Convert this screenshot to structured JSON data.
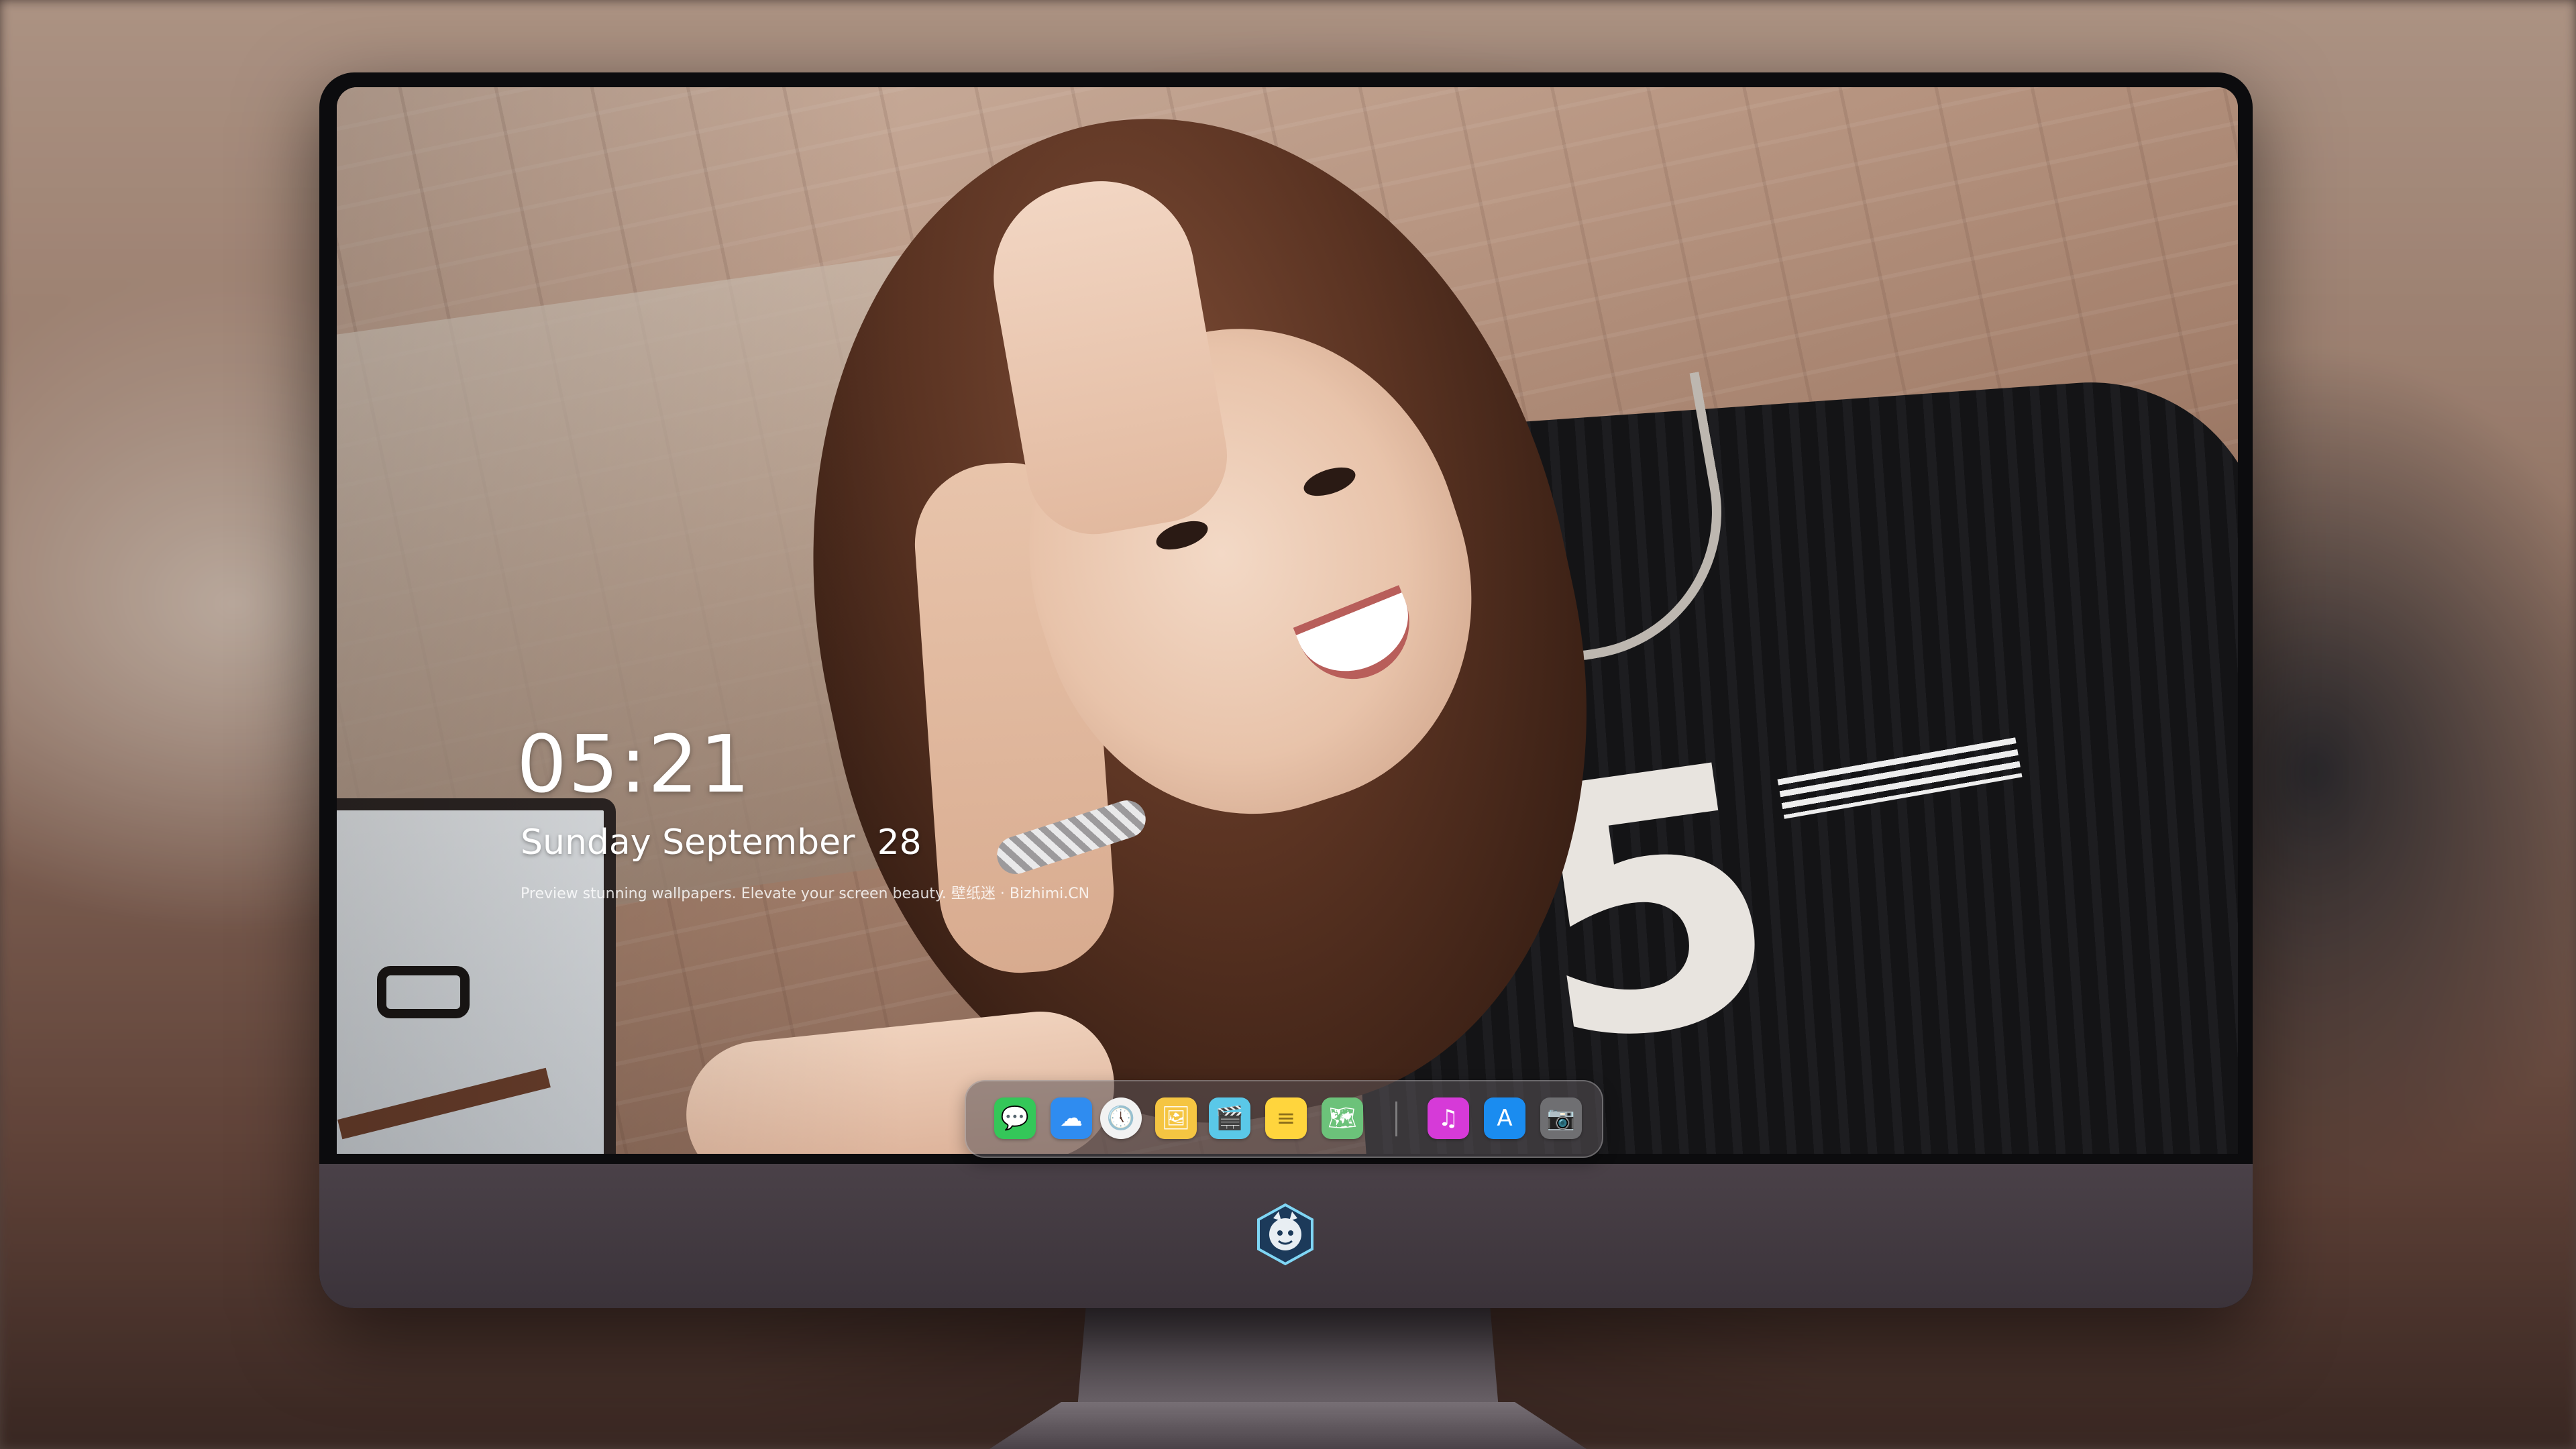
{
  "lock_screen": {
    "time": "05:21",
    "date": "Sunday September  28",
    "tagline": "Preview stunning wallpapers. Elevate your screen beauty. 壁纸迷 · Bizhimi.CN"
  },
  "wallpaper": {
    "shirt_number": "5"
  },
  "dock": {
    "apps": [
      {
        "name": "Messages",
        "icon": "messages-icon",
        "glyph": "💬",
        "color": "#34c759"
      },
      {
        "name": "Weather",
        "icon": "weather-icon",
        "glyph": "☁",
        "color": "#2f8cf0"
      },
      {
        "name": "Clock",
        "icon": "clock-icon",
        "glyph": "🕔",
        "color": "#f2f2f2"
      },
      {
        "name": "Preview",
        "icon": "preview-icon",
        "glyph": "🖼",
        "color": "#f5c542"
      },
      {
        "name": "Video",
        "icon": "video-icon",
        "glyph": "🎬",
        "color": "#5ac8e8"
      },
      {
        "name": "Notes",
        "icon": "notes-icon",
        "glyph": "≡",
        "color": "#ffd53d"
      },
      {
        "name": "Maps",
        "icon": "maps-icon",
        "glyph": "🗺",
        "color": "#6cc27a"
      },
      {
        "name": "Music",
        "icon": "music-icon",
        "glyph": "♫",
        "color": "#d63ad8"
      },
      {
        "name": "App Store",
        "icon": "app-store-icon",
        "glyph": "A",
        "color": "#1a8cf0"
      },
      {
        "name": "Camera",
        "icon": "camera-icon",
        "glyph": "📷",
        "color": "#6f6f72"
      }
    ]
  },
  "colors": {
    "monitor_bezel": "#0c0c0e",
    "monitor_chin": "#433a41",
    "dock_bg": "#5a545a"
  }
}
